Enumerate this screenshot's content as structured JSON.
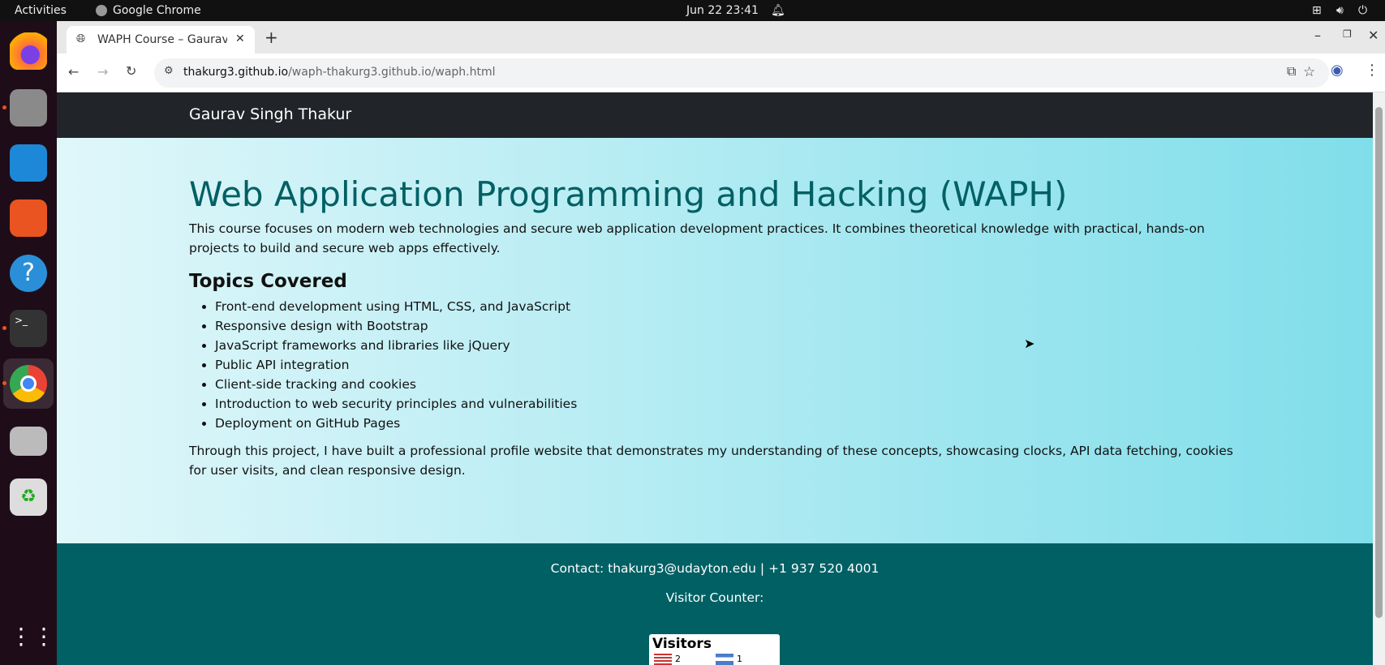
{
  "system": {
    "activities": "Activities",
    "app_name": "Google Chrome",
    "datetime": "Jun 22  23:41"
  },
  "dock": [
    "firefox",
    "files",
    "libreoffice-writer",
    "app-center",
    "help",
    "terminal",
    "chrome",
    "disk",
    "trash",
    "show-apps"
  ],
  "browser": {
    "tab_title": "WAPH Course – Gaurav S",
    "url_host": "thakurg3.github.io",
    "url_path": "/waph-thakurg3.github.io/waph.html"
  },
  "page": {
    "brand": "Gaurav Singh Thakur",
    "title": "Web Application Programming and Hacking (WAPH)",
    "intro": "This course focuses on modern web technologies and secure web application development practices. It combines theoretical knowledge with practical, hands-on projects to build and secure web apps effectively.",
    "topics_heading": "Topics Covered",
    "topics": [
      "Front-end development using HTML, CSS, and JavaScript",
      "Responsive design with Bootstrap",
      "JavaScript frameworks and libraries like jQuery",
      "Public API integration",
      "Client-side tracking and cookies",
      "Introduction to web security principles and vulnerabilities",
      "Deployment on GitHub Pages"
    ],
    "closing": "Through this project, I have built a professional profile website that demonstrates my understanding of these concepts, showcasing clocks, API data fetching, cookies for user visits, and clean responsive design.",
    "contact": "Contact: thakurg3@udayton.edu | +1 937 520 4001",
    "visitor_label": "Visitor Counter:",
    "widget": {
      "title": "Visitors",
      "entries": [
        {
          "flag": "us-flag",
          "count": "2"
        },
        {
          "flag": "el-salvador-flag",
          "count": "1"
        }
      ]
    }
  },
  "colors": {
    "accent": "#006064",
    "nav": "#212529"
  }
}
